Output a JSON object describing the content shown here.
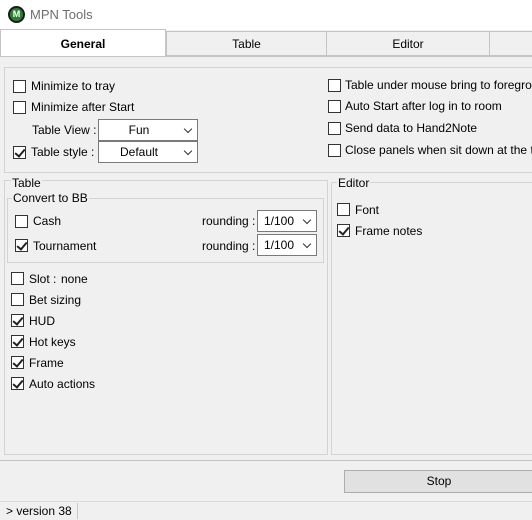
{
  "window": {
    "title": "MPN Tools",
    "icon_letter": "M"
  },
  "tabs": [
    {
      "label": "General",
      "active": true
    },
    {
      "label": "Table",
      "active": false
    },
    {
      "label": "Editor",
      "active": false
    }
  ],
  "general": {
    "minimize_to_tray": {
      "label": "Minimize to tray",
      "checked": false
    },
    "minimize_after_start": {
      "label": "Minimize after Start",
      "checked": false
    },
    "table_view": {
      "label": "Table View :",
      "value": "Fun"
    },
    "table_style": {
      "label": "Table style :",
      "value": "Default",
      "checked": true
    },
    "table_under_mouse": {
      "label": "Table under mouse bring to foreground",
      "checked": false
    },
    "auto_start": {
      "label": "Auto Start after log in to room",
      "checked": false
    },
    "send_data": {
      "label": "Send data to Hand2Note",
      "checked": false
    },
    "close_panels": {
      "label": "Close panels when sit down at the table",
      "checked": false
    }
  },
  "table_section": {
    "title": "Table",
    "convert_to_bb": "Convert to BB",
    "cash": {
      "label": "Cash",
      "checked": false,
      "rounding_label": "rounding :",
      "rounding_value": "1/100"
    },
    "tournament": {
      "label": "Tournament",
      "checked": true,
      "rounding_label": "rounding :",
      "rounding_value": "1/100"
    },
    "slot": {
      "label": "Slot :",
      "value": "none",
      "checked": false
    },
    "bet_sizing": {
      "label": "Bet sizing",
      "checked": false
    },
    "hud": {
      "label": "HUD",
      "checked": true
    },
    "hot_keys": {
      "label": "Hot keys",
      "checked": true
    },
    "frame": {
      "label": "Frame",
      "checked": true
    },
    "auto_actions": {
      "label": "Auto actions",
      "checked": true
    }
  },
  "editor_section": {
    "title": "Editor",
    "font": {
      "label": "Font",
      "checked": false
    },
    "frame_notes": {
      "label": "Frame notes",
      "checked": true
    }
  },
  "footer": {
    "stop_label": "Stop",
    "status": "> version 38"
  }
}
